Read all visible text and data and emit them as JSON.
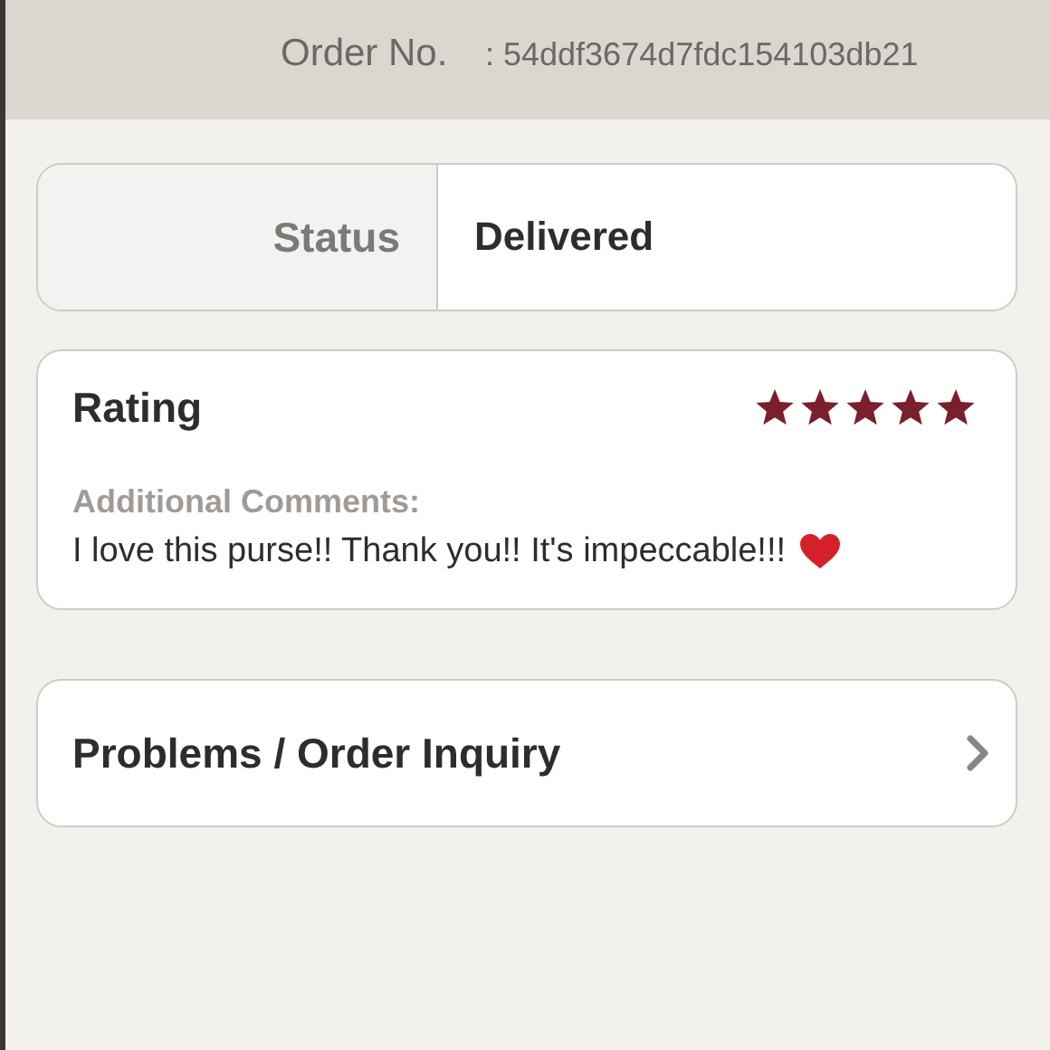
{
  "order_info": [
    {
      "label": "Order No.",
      "value": ": 54ddf3674d7fdc154103db21"
    }
  ],
  "status": {
    "label": "Status",
    "value": "Delivered"
  },
  "rating": {
    "title": "Rating",
    "stars": 5,
    "comments_label": "Additional Comments:",
    "comment": "I love this purse!! Thank you!! It's impeccable!!!"
  },
  "inquiry": {
    "label": "Problems / Order Inquiry"
  }
}
